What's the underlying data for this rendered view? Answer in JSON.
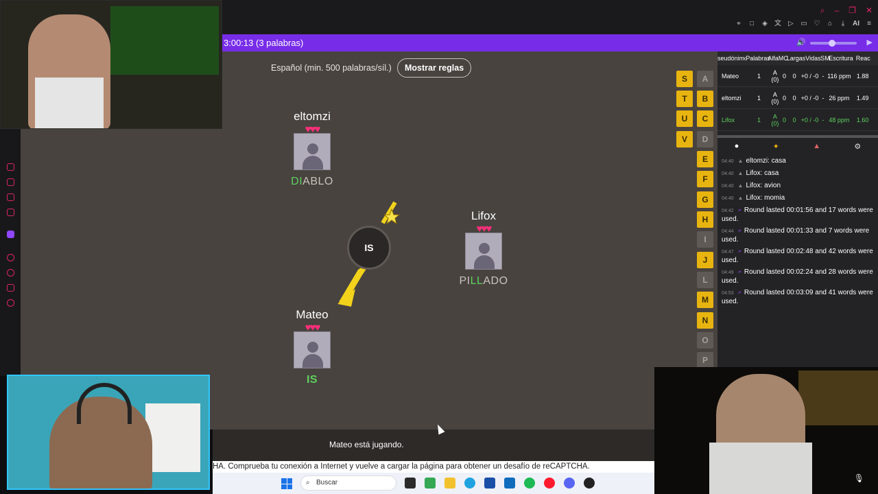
{
  "game": {
    "timer_text": "3:00:13 (3 palabras)",
    "rules_label": "Español (min. 500 palabras/síl.)",
    "rules_button": "Mostrar reglas",
    "bomb_syllable": "IS",
    "status": "Mateo está jugando.",
    "players": [
      {
        "name": "eltomzi",
        "hearts": "♥♥♥",
        "word_highlight": "DI",
        "word_rest": "ABLO"
      },
      {
        "name": "Lifox",
        "hearts": "♥♥♥",
        "word_prefix": "PI",
        "word_highlight": "LL",
        "word_rest": "ADO"
      },
      {
        "name": "Mateo",
        "hearts": "♥♥♥",
        "word": "IS"
      }
    ],
    "letters_used": [
      "S",
      "T",
      "U",
      "V"
    ],
    "letters": [
      "A",
      "B",
      "C",
      "D",
      "E",
      "F",
      "G",
      "H",
      "I",
      "J",
      "L",
      "M",
      "N",
      "O",
      "P"
    ],
    "letters_highlighted": [
      "A",
      "B",
      "C",
      "E",
      "F",
      "G",
      "H",
      "J",
      "M",
      "N"
    ]
  },
  "scoreboard": {
    "headers": [
      "seudónimo",
      "Palabras",
      "Alfa",
      "MC",
      "Largas",
      "Vidas",
      "SM",
      "Escritura",
      "Reac"
    ],
    "rows": [
      {
        "name": "Mateo",
        "words": "1",
        "alfa": "A (0)",
        "mc": "0",
        "largas": "0",
        "vidas": "+0 / -0",
        "sm": "-",
        "escritura": "116 ppm",
        "reac": "1.88"
      },
      {
        "name": "eltomzi",
        "words": "1",
        "alfa": "A (0)",
        "mc": "0",
        "largas": "0",
        "vidas": "+0 / -0",
        "sm": "-",
        "escritura": "26 ppm",
        "reac": "1.49"
      },
      {
        "name": "Lifox",
        "words": "1",
        "alfa": "A (0)",
        "mc": "0",
        "largas": "0",
        "vidas": "+0 / -0",
        "sm": "-",
        "escritura": "48 ppm",
        "reac": "1.60"
      }
    ]
  },
  "chat": [
    {
      "time": "04:40",
      "text": "eltomzi: casa"
    },
    {
      "time": "04:40",
      "text": "Lifox: casa"
    },
    {
      "time": "04:40",
      "text": "Lifox: avion"
    },
    {
      "time": "04:40",
      "text": "Lifox: momia"
    },
    {
      "time": "04:42",
      "text": "Round lasted 00:01:56 and 17 words were used."
    },
    {
      "time": "04:44",
      "text": "Round lasted 00:01:33 and 7 words were used."
    },
    {
      "time": "04:47",
      "text": "Round lasted 00:02:48 and 42 words were used."
    },
    {
      "time": "04:49",
      "text": "Round lasted 00:02:24 and 28 words were used."
    },
    {
      "time": "04:53",
      "text": "Round lasted 00:03:09 and 41 words were used."
    }
  ],
  "browser": {
    "error_text": "HA. Comprueba tu conexión a Internet y vuelve a cargar la página para obtener un desafío de reCAPTCHA.",
    "toolbar_ai": "AI"
  },
  "taskbar": {
    "search_placeholder": "Buscar"
  },
  "icons": {
    "speaker": "speaker-icon",
    "play": "play-icon",
    "chat_tab": "chat-bubble-icon",
    "players_tab": "people-icon",
    "settings_tab": "gear-icon"
  },
  "colors": {
    "accent": "#772ce8",
    "highlight_green": "#5ed25e",
    "heart": "#ff2e7a",
    "letter_used": "#e8b410"
  }
}
